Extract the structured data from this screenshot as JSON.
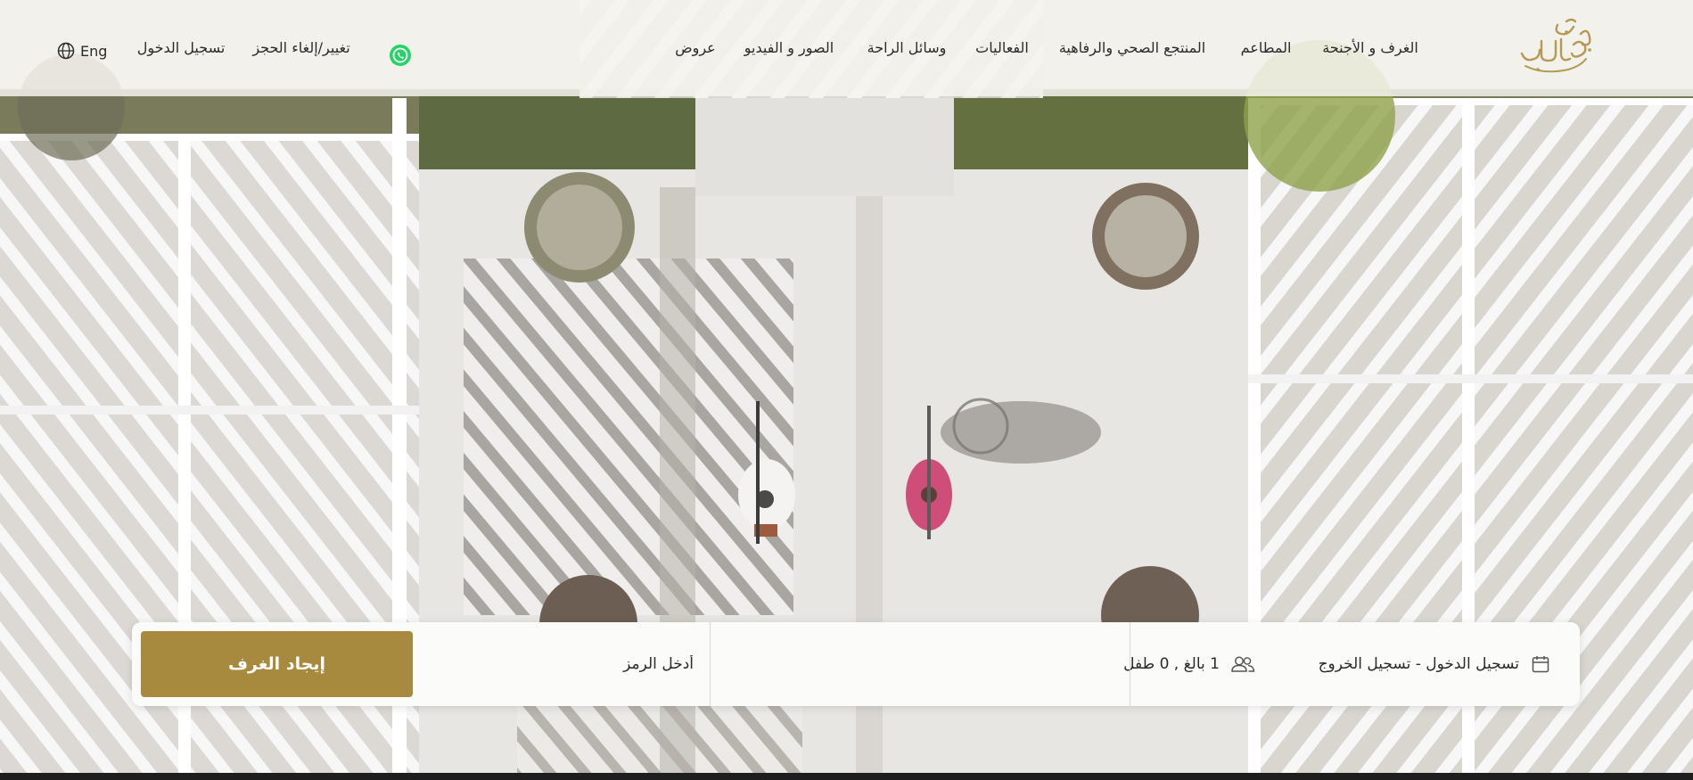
{
  "brand": {
    "logo_text_line1": "فندق",
    "logo_text_line2": "العلاين",
    "logo_color": "#b49a52"
  },
  "nav": {
    "items": [
      {
        "label": "الغرف و الأجنحة"
      },
      {
        "label": "المطاعم"
      },
      {
        "label": "المنتجع الصحي والرفاهية"
      },
      {
        "label": "الفعاليات"
      },
      {
        "label": "وسائل الراحة"
      },
      {
        "label": "الصور و الفيديو"
      },
      {
        "label": "عروض"
      }
    ],
    "whatsapp_icon": "whatsapp-icon",
    "manage_booking": "تغيير/إلغاء الحجز",
    "login": "تسجيل الدخول",
    "language": "Eng",
    "language_icon": "globe-icon"
  },
  "booking": {
    "dates_label": "تسجيل الدخول - تسجيل الخروج",
    "dates_icon": "calendar-icon",
    "guests_label": "1 بالغ , 0 طفل",
    "guests_icon": "users-icon",
    "promo_value": "",
    "promo_placeholder": "أدخل الرمز",
    "search_button": "إيجاد الغرف",
    "accent_color": "#a88a3e"
  }
}
